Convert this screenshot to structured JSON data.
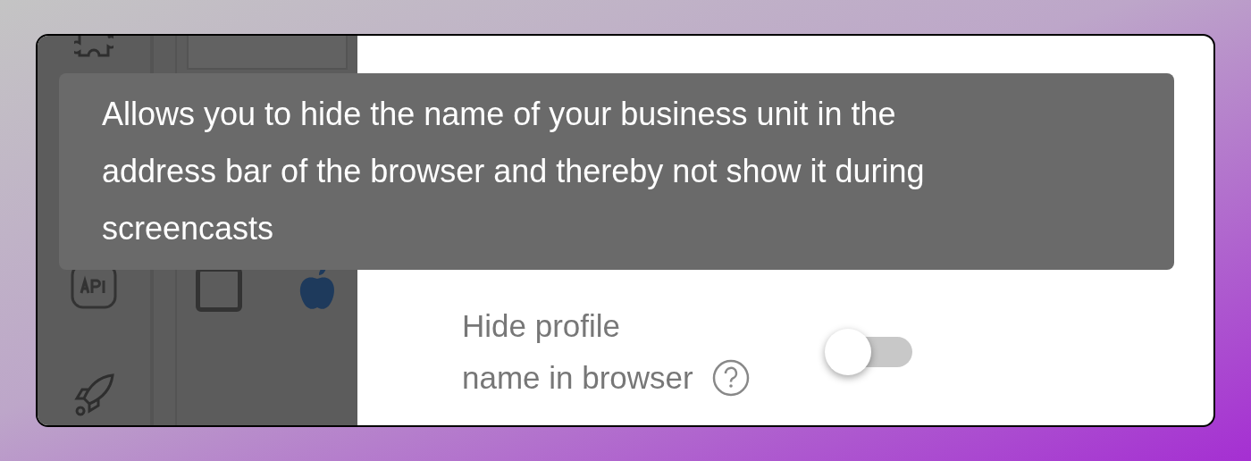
{
  "settings": [
    {
      "label": "Hide profile name in browser",
      "on": false
    }
  ],
  "tooltip": {
    "text": "Allows you to hide the name of your business unit in the address bar of the browser and thereby not show it during screencasts"
  }
}
